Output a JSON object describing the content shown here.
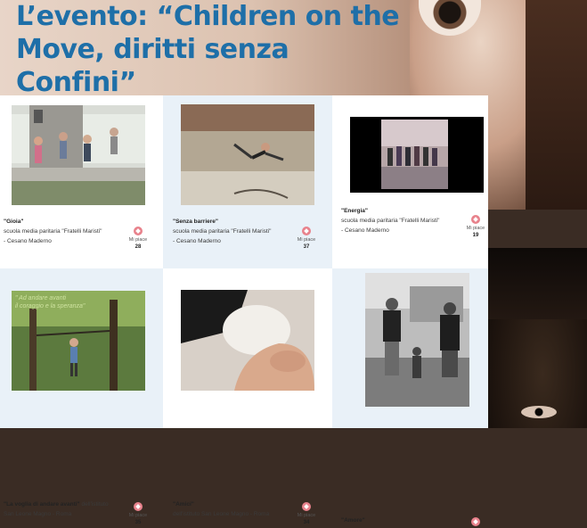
{
  "header": {
    "title": "L’evento: “Children on the Move, diritti senza Confini”"
  },
  "cards": [
    {
      "title": "\"Gioia\"",
      "line1": "scuola media paritaria \"Fratelli Maristi\"",
      "line2": "- Cesano Maderno",
      "like_label": "Mi piace",
      "likes": "28"
    },
    {
      "title": "\"Senza barriere\"",
      "line1": "scuola media paritaria \"Fratelli Maristi\"",
      "line2": "- Cesano Maderno",
      "like_label": "Mi piace",
      "likes": "37"
    },
    {
      "title": "\"Energia\"",
      "line1": "scuola media paritaria \"Fratelli Maristi\"",
      "line2": "- Cesano Maderno",
      "like_label": "Mi piace",
      "likes": "19"
    },
    {
      "title": "\"La voglia di andare avanti\"",
      "line1": "dell'istituto",
      "line2": "San Leone Magno - Roma",
      "like_label": "Mi piace",
      "likes": "35"
    },
    {
      "title": "\"Amici\"",
      "line1": "dell'istituto San Leone Magno - Roma",
      "line2": "",
      "like_label": "Mi piace",
      "likes": "34"
    },
    {
      "title": "\"Amore\"",
      "line1": "",
      "line2": "",
      "like_label": "",
      "likes": ""
    }
  ]
}
